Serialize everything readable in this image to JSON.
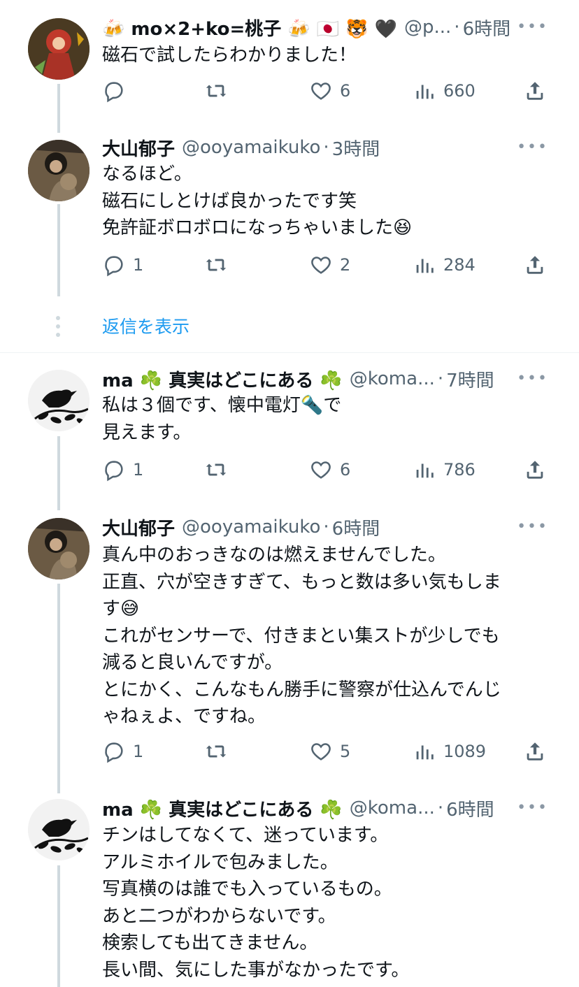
{
  "colors": {
    "text": "#0f1419",
    "secondary": "#536471",
    "link": "#1d9bf0",
    "thread_line": "#cfd9de",
    "divider": "#eff3f4"
  },
  "tweets": [
    {
      "name": "🍻 mo×2+ko=桃子 🍻 🇯🇵 🐯 🖤",
      "handle": "@p...",
      "time": "6時間",
      "lines": [
        "磁石で試したらわかりました！"
      ],
      "replies": "",
      "likes": "6",
      "views": "660"
    },
    {
      "name": "大山郁子",
      "handle": "@ooyamaikuko",
      "time": "3時間",
      "lines": [
        "なるほど。",
        "磁石にしとけば良かったです笑",
        "免許証ボロボロになっちゃいました😆"
      ],
      "replies": "1",
      "likes": "2",
      "views": "284"
    },
    {
      "name": "ma ☘️ 真実はどこにある ☘️",
      "handle": "@koma...",
      "time": "7時間",
      "lines": [
        "私は３個です、懐中電灯🔦で",
        "見えます。"
      ],
      "replies": "1",
      "likes": "6",
      "views": "786"
    },
    {
      "name": "大山郁子",
      "handle": "@ooyamaikuko",
      "time": "6時間",
      "lines": [
        "真ん中のおっきなのは燃えませんでした。",
        "正直、穴が空きすぎて、もっと数は多い気もしま",
        "す😅",
        "これがセンサーで、付きまとい集ストが少しでも",
        "減ると良いんですが。",
        "とにかく、こんなもん勝手に警察が仕込んでんじ",
        "ゃねぇよ、ですね。"
      ],
      "replies": "1",
      "likes": "5",
      "views": "1089"
    },
    {
      "name": "ma ☘️ 真実はどこにある ☘️",
      "handle": "@koma...",
      "time": "6時間",
      "lines": [
        "チンはしてなくて、迷っています。",
        "アルミホイルで包みました。",
        "写真横のは誰でも入っているもの。",
        "あと二つがわからないです。",
        "検索しても出てきません。",
        "長い間、気にした事がなかったです。"
      ]
    }
  ],
  "show_replies_label": "返信を表示",
  "icons": {
    "reply": "reply-icon",
    "retweet": "retweet-icon",
    "like": "heart-icon",
    "views": "views-icon",
    "share": "share-icon",
    "more": "more-icon"
  }
}
